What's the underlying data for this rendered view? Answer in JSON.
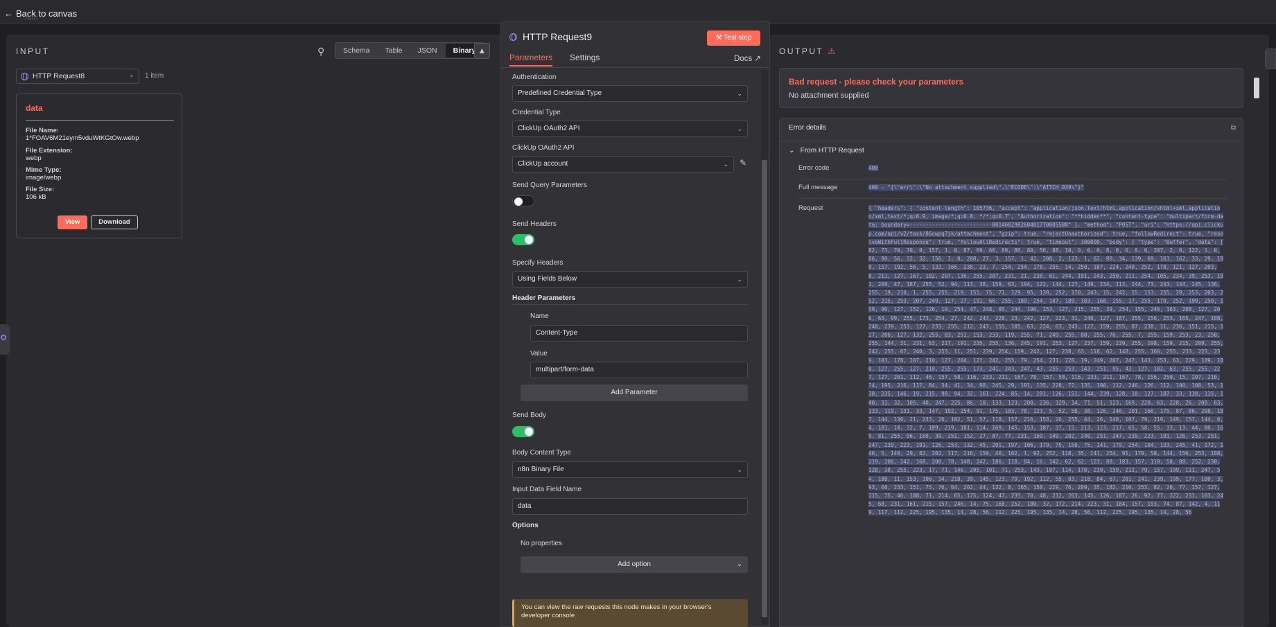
{
  "topbar": {
    "back_label": "Back to canvas",
    "ghost_text": "n8n"
  },
  "input": {
    "title": "INPUT",
    "view_tabs": [
      "Schema",
      "Table",
      "JSON",
      "Binary"
    ],
    "active_view": "Binary",
    "node_select": "HTTP Request8",
    "item_count": "1 item",
    "binary": {
      "key": "data",
      "fields": [
        {
          "label": "File Name:",
          "value": "1*FOAV6M21eym5vduWtKGtOw.webp"
        },
        {
          "label": "File Extension:",
          "value": "webp"
        },
        {
          "label": "Mime Type:",
          "value": "image/webp"
        },
        {
          "label": "File Size:",
          "value": "106 kB"
        }
      ],
      "view_label": "View",
      "download_label": "Download"
    }
  },
  "node": {
    "title": "HTTP Request9",
    "test_label": "Test step",
    "tabs": [
      "Parameters",
      "Settings"
    ],
    "active_tab": "Parameters",
    "docs_label": "Docs",
    "params": {
      "authentication_label": "Authentication",
      "authentication_value": "Predefined Credential Type",
      "credential_type_label": "Credential Type",
      "credential_type_value": "ClickUp OAuth2 API",
      "clickup_label": "ClickUp OAuth2 API",
      "clickup_value": "ClickUp account",
      "send_query_label": "Send Query Parameters",
      "send_query_on": false,
      "send_headers_label": "Send Headers",
      "send_headers_on": true,
      "specify_headers_label": "Specify Headers",
      "specify_headers_value": "Using Fields Below",
      "header_params_label": "Header Parameters",
      "name_label": "Name",
      "name_value": "Content-Type",
      "value_label": "Value",
      "value_value": "multipart/form-data",
      "add_param_label": "Add Parameter",
      "send_body_label": "Send Body",
      "send_body_on": true,
      "body_type_label": "Body Content Type",
      "body_type_value": "n8n Binary File",
      "input_field_label": "Input Data Field Name",
      "input_field_value": "data",
      "options_label": "Options",
      "no_properties": "No properties",
      "add_option_label": "Add option",
      "info": "You can view the raw requests this node makes in your browser's developer console"
    }
  },
  "output": {
    "title": "OUTPUT",
    "error_title": "Bad request - please check your parameters",
    "error_sub": "No attachment supplied",
    "details_label": "Error details",
    "from_label": "From HTTP Request",
    "rows": [
      {
        "key": "Error code",
        "value": "400"
      },
      {
        "key": "Full message",
        "value": "400 - \"{\\\"err\\\":\\\"No attachment supplied\\\",\\\"ECODE\\\":\\\"ATTCH_039\\\"}\""
      },
      {
        "key": "Request",
        "value": "{ \"headers\": { \"content-length\": 105736, \"accept\": \"application/json,text/html,application/xhtml+xml,application/xml,text/*;q=0.9, image/*;q=0.8, */*;q=0.7\", \"Authorization\": \"**hidden**\", \"content-type\": \"multipart/form-data; boundary=--------------------------001468298260401770005588\" }, \"method\": \"POST\", \"uri\": \"https://api.clickup.com/api/v2/task/86cwpq7jk/attachment\", \"gzip\": true, \"rejectUnauthorized\": true, \"followRedirect\": true, \"resolveWithFullResponse\": true, \"followAllRedirects\": true, \"timeout\": 300000, \"body\": { \"type\": \"Buffer\", \"data\": [ 82, 73, 70, 70, 0, 157, 1, 0, 87, 69, 66, 80, 86, 80, 56, 88, 10, 0, 0, 0, 8, 0, 0, 0, 0, 207, 2, 0, 122, 1, 0, 86, 80, 56, 32, 32, 156, 1, 0, 208, 27, 3, 157, 1, 42, 208, 2, 123, 1, 62, 89, 34, 139, 69, 163, 162, 33, 29, 190, 157, 192, 56, 5, 132, 166, 238, 23, 7, 254, 254, 178, 255, 14, 250, 187, 224, 240, 252, 178, 121, 127, 203, 8, 211, 127, 167, 182, 207, 136, 255, 207, 231, 21, 238, 61, 244, 191, 243, 250, 211, 254, 105, 234, 39, 253, 191, 209, 47, 167, 255, 52, 94, 113, 38, 159, 63, 194, 122, 144, 127, 149, 234, 113, 244, 73, 243, 144, 245, 136, 255, 19, 210, 1, 255, 255, 219, 151, 75, 71, 129, 95, 139, 252, 170, 243, 15, 242, 15, 153, 255, 29, 253, 203, 252, 215, 253, 207, 249, 127, 27, 191, 66, 255, 189, 254, 147, 189, 103, 168, 255, 17, 255, 179, 252, 199, 250, 159, 96, 127, 152, 126, 19, 254, 47, 248, 95, 244, 190, 153, 127, 215, 255, 39, 254, 155, 246, 163, 208, 127, 206, 63, 99, 255, 173, 254, 27, 242, 243, 228, 23, 242, 127, 223, 31, 240, 127, 187, 255, 156, 253, 165, 247, 198, 248, 239, 253, 127, 233, 255, 212, 247, 155, 105, 63, 224, 63, 243, 127, 159, 255, 87, 238, 11, 236, 151, 215, 127, 206, 127, 132, 255, 83, 251, 153, 233, 119, 255, 71, 249, 255, 80, 255, 76, 255, 7, 255, 159, 253, 23, 250, 255, 144, 31, 231, 63, 217, 191, 235, 255, 136, 245, 191, 253, 127, 237, 159, 239, 255, 198, 159, 215, 209, 255, 242, 255, 67, 240, 3, 253, 11, 251, 239, 254, 159, 242, 127, 238, 63, 118, 62, 148, 255, 166, 255, 233, 223, 239, 103, 178, 207, 210, 127, 204, 127, 242, 255, 79, 254, 231, 228, 19, 249, 207, 247, 143, 253, 63, 229, 189, 180, 127, 255, 127, 210, 255, 255, 173, 241, 243, 247, 43, 255, 253, 143, 251, 95, 43, 127, 182, 63, 255, 255, 227, 127, 201, 112, 46, 157, 58, 116, 233, 211, 167, 78, 157, 58, 116, 233, 211, 167, 78, 156, 250, 15, 207, 210, 74, 195, 216, 117, 84, 34, 41, 34, 98, 245, 29, 191, 135, 228, 72, 135, 198, 112, 246, 126, 112, 100, 108, 53, 138, 235, 146, 19, 215, 98, 94, 32, 161, 224, 85, 14, 191, 126, 151, 144, 239, 128, 10, 127, 187, 33, 138, 115, 140, 31, 32, 105, 40, 247, 225, 86, 10, 133, 123, 200, 236, 129, 14, 71, 51, 123, 169, 220, 63, 228, 26, 209, 63, 133, 119, 131, 33, 147, 192, 254, 91, 175, 103, 78, 123, 5, 52, 58, 38, 126, 246, 201, 166, 175, 87, 86, 208, 187, 144, 130, 21, 233, 26, 102, 51, 57, 118, 157, 216, 153, 26, 255, 44, 26, 148, 107, 79, 219, 149, 157, 144, 0, 4, 101, 14, 72, 7, 189, 219, 181, 114, 169, 145, 153, 187, 37, 15, 213, 123, 217, 65, 58, 55, 33, 13, 44, 80, 169, 81, 255, 96, 169, 39, 251, 152, 27, 87, 77, 231, 169, 149, 202, 240, 251, 247, 239, 223, 191, 126, 253, 251, 247, 239, 223, 191, 126, 253, 132, 45, 201, 197, 106, 179, 75, 150, 75, 141, 179, 254, 104, 133, 245, 41, 172, 146, 5, 149, 29, 82, 202, 117, 216, 159, 40, 162, 1, 92, 252, 118, 35, 141, 254, 91, 179, 58, 144, 156, 253, 188, 219, 206, 142, 168, 200, 78, 148, 242, 186, 118, 84, 16, 142, 62, 62, 123, 88, 183, 157, 110, 58, 88, 252, 230, 128, 38, 255, 223, 17, 71, 146, 205, 101, 71, 253, 143, 187, 114, 178, 239, 159, 212, 79, 157, 199, 111, 247, 54, 188, 11, 153, 106, 34, 218, 39, 145, 123, 79, 192, 112, 55, 83, 218, 84, 67, 201, 241, 239, 199, 177, 180, 3, 93, 60, 233, 151, 75, 76, 64, 202, 44, 132, 8, 165, 158, 229, 76, 209, 35, 182, 210, 253, 82, 20, 77, 157, 127, 115, 75, 46, 108, 71, 214, 65, 175, 124, 47, 235, 70, 48, 212, 203, 145, 126, 187, 26, 92, 77, 222, 231, 103, 245, 68, 231, 161, 215, 157, 246, 14, 75, 168, 252, 180, 32, 172, 214, 223, 31, 184, 157, 193, 74, 87, 142, 4, 119, 117, 112, 225, 195, 135, 14, 28, 56, 112, 225, 195, 135, 14, 28, 56, 112, 225, 195, 135, 14, 28, 56"
      }
    ]
  }
}
